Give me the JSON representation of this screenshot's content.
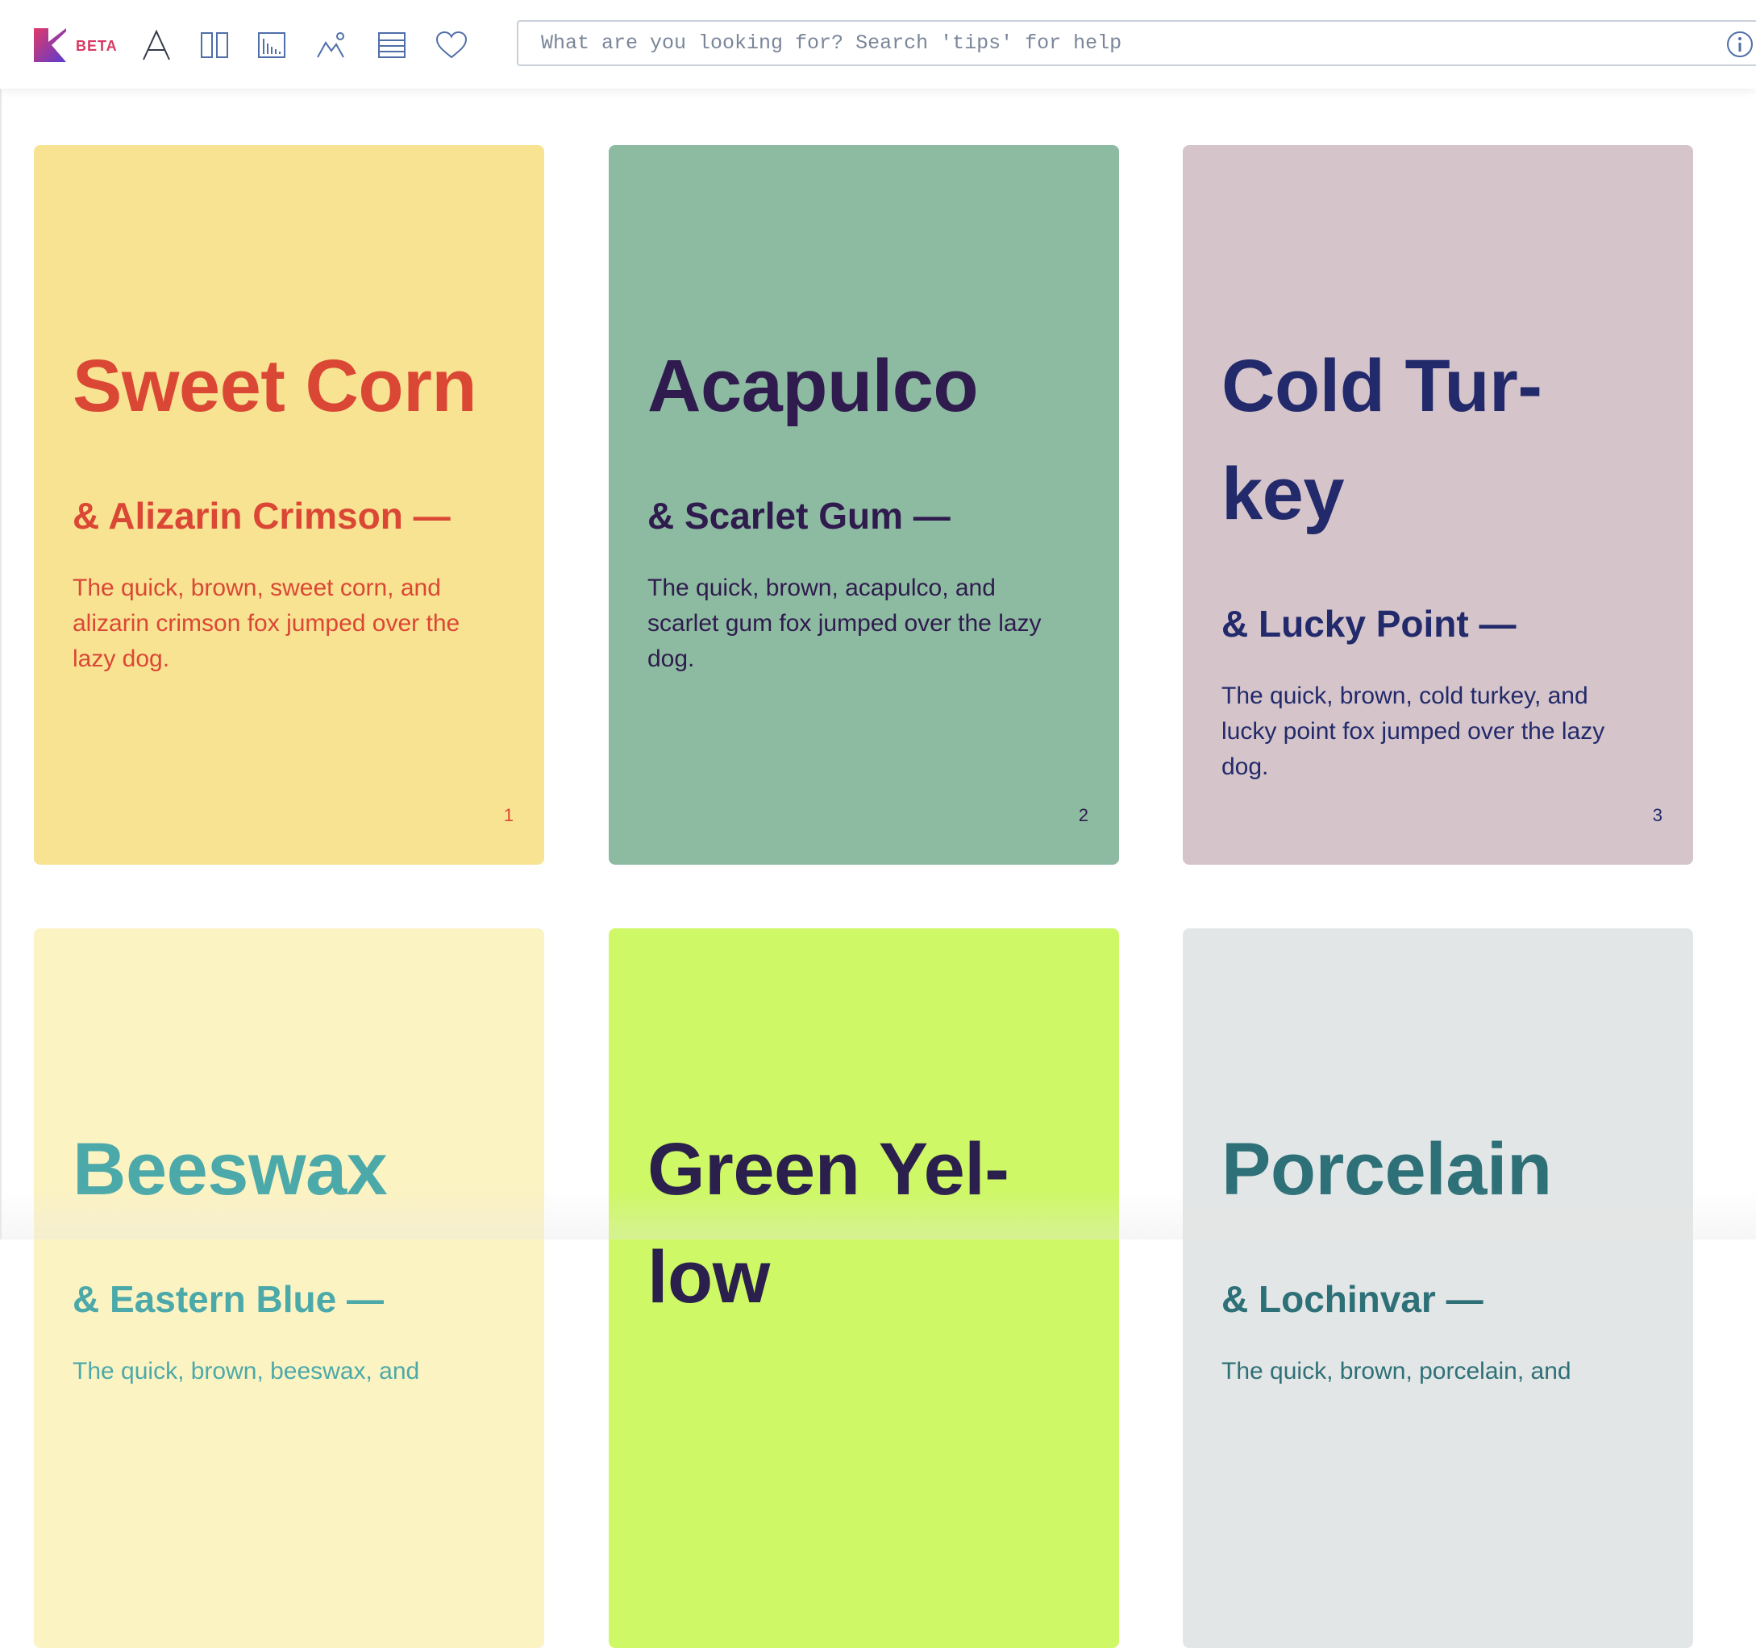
{
  "app": {
    "beta_label": "BETA"
  },
  "toolbar": {
    "tools": [
      {
        "name": "typography-icon"
      },
      {
        "name": "columns-icon"
      },
      {
        "name": "chart-icon"
      },
      {
        "name": "image-icon"
      },
      {
        "name": "table-icon"
      },
      {
        "name": "heart-icon"
      }
    ],
    "search_placeholder": "What are you looking for? Search 'tips' for help"
  },
  "cards": [
    {
      "title": "Sweet Corn",
      "subtitle": "& Alizarin Crimson —",
      "body": "The quick, brown, sweet corn, and alizarin crimson fox jumped over the lazy dog.",
      "number": "1",
      "bg": "#f8e393",
      "fg": "#db4735"
    },
    {
      "title": "Acapulco",
      "subtitle": "& Scarlet Gum —",
      "body": "The quick, brown, acapulco, and scarlet gum fox jumped over the lazy dog.",
      "number": "2",
      "bg": "#8dbba1",
      "fg": "#2f1b4e"
    },
    {
      "title": "Cold Tur-\nkey",
      "subtitle": "& Lucky Point —",
      "body": "The quick, brown, cold turkey, and lucky point fox jumped over the lazy dog.",
      "number": "3",
      "bg": "#d5c4ca",
      "fg": "#222a6b"
    },
    {
      "title": "Beeswax",
      "subtitle": "& Eastern Blue —",
      "body": "The quick, brown, beeswax, and",
      "number": "",
      "bg": "#fcf3c3",
      "fg": "#4ca9a9"
    },
    {
      "title": "Green Yel-\nlow",
      "subtitle": "",
      "body": "",
      "number": "",
      "bg": "#cef865",
      "fg": "#2a1f4d"
    },
    {
      "title": "Porcelain",
      "subtitle": "& Lochinvar —",
      "body": "The quick, brown, porcelain, and",
      "number": "",
      "bg": "#e3e6e6",
      "fg": "#2e7077"
    }
  ],
  "colors": {
    "logo_gradient": [
      "#d93a6b",
      "#6a3bc9"
    ],
    "icon_stroke": "#4f6fa8",
    "beta": "#d63a64"
  }
}
